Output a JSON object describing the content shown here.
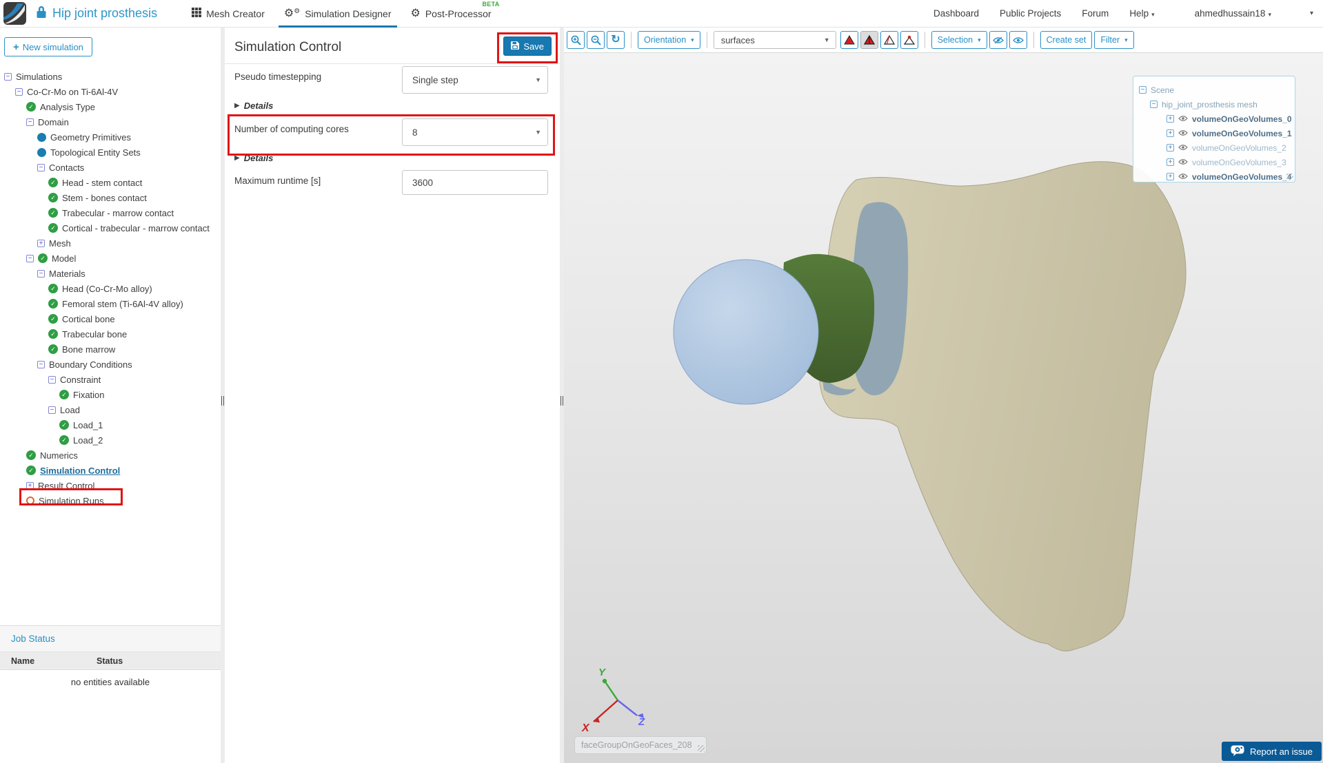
{
  "header": {
    "project_title": "Hip joint prosthesis",
    "lock_icon": "lock-icon",
    "tabs": [
      {
        "label": "Mesh Creator",
        "icon": "grid-icon",
        "active": false
      },
      {
        "label": "Simulation Designer",
        "icon": "gears-icon",
        "active": true
      },
      {
        "label": "Post-Processor",
        "icon": "gear-icon",
        "badge": "BETA",
        "active": false
      }
    ],
    "nav": [
      "Dashboard",
      "Public Projects",
      "Forum"
    ],
    "help_label": "Help",
    "username": "ahmedhussain18"
  },
  "sidebar": {
    "new_simulation_label": "New simulation",
    "tree": [
      {
        "level": 0,
        "icons": [
          "minus"
        ],
        "label": "Simulations"
      },
      {
        "level": 1,
        "icons": [
          "minus"
        ],
        "label": "Co-Cr-Mo on Ti-6Al-4V"
      },
      {
        "level": 2,
        "icons": [
          "check"
        ],
        "label": "Analysis Type"
      },
      {
        "level": 2,
        "icons": [
          "minus"
        ],
        "label": "Domain"
      },
      {
        "level": 3,
        "icons": [
          "dot"
        ],
        "label": "Geometry Primitives"
      },
      {
        "level": 3,
        "icons": [
          "dot"
        ],
        "label": "Topological Entity Sets"
      },
      {
        "level": 3,
        "icons": [
          "minus"
        ],
        "label": "Contacts"
      },
      {
        "level": 4,
        "icons": [
          "check"
        ],
        "label": "Head - stem contact"
      },
      {
        "level": 4,
        "icons": [
          "check"
        ],
        "label": "Stem - bones contact"
      },
      {
        "level": 4,
        "icons": [
          "check"
        ],
        "label": "Trabecular - marrow contact"
      },
      {
        "level": 4,
        "icons": [
          "check"
        ],
        "label": "Cortical - trabecular - marrow contact"
      },
      {
        "level": 3,
        "icons": [
          "plus"
        ],
        "label": "Mesh"
      },
      {
        "level": 2,
        "icons": [
          "minus",
          "check"
        ],
        "label": "Model"
      },
      {
        "level": 3,
        "icons": [
          "minus"
        ],
        "label": "Materials"
      },
      {
        "level": 4,
        "icons": [
          "check"
        ],
        "label": "Head (Co-Cr-Mo alloy)"
      },
      {
        "level": 4,
        "icons": [
          "check"
        ],
        "label": "Femoral stem (Ti-6Al-4V alloy)"
      },
      {
        "level": 4,
        "icons": [
          "check"
        ],
        "label": "Cortical bone"
      },
      {
        "level": 4,
        "icons": [
          "check"
        ],
        "label": "Trabecular bone"
      },
      {
        "level": 4,
        "icons": [
          "check"
        ],
        "label": "Bone marrow"
      },
      {
        "level": 3,
        "icons": [
          "minus"
        ],
        "label": "Boundary Conditions"
      },
      {
        "level": 4,
        "icons": [
          "minus"
        ],
        "label": "Constraint"
      },
      {
        "level": 5,
        "icons": [
          "check"
        ],
        "label": "Fixation"
      },
      {
        "level": 4,
        "icons": [
          "minus"
        ],
        "label": "Load"
      },
      {
        "level": 5,
        "icons": [
          "check"
        ],
        "label": "Load_1"
      },
      {
        "level": 5,
        "icons": [
          "check"
        ],
        "label": "Load_2"
      },
      {
        "level": 2,
        "icons": [
          "check"
        ],
        "label": "Numerics"
      },
      {
        "level": 2,
        "icons": [
          "check"
        ],
        "label": "Simulation Control",
        "selected": true
      },
      {
        "level": 2,
        "icons": [
          "plus"
        ],
        "label": "Result Control"
      },
      {
        "level": 2,
        "icons": [
          "circle"
        ],
        "label": "Simulation Runs"
      }
    ],
    "job_status": {
      "title": "Job Status",
      "columns": [
        "Name",
        "Status"
      ],
      "empty_text": "no entities available"
    }
  },
  "panel": {
    "title": "Simulation Control",
    "save_label": "Save",
    "details_label": "Details",
    "fields": [
      {
        "label": "Pseudo timestepping",
        "type": "select",
        "value": "Single step"
      },
      {
        "label": "Number of computing cores",
        "type": "select",
        "value": "8",
        "highlighted": true
      },
      {
        "label": "Maximum runtime [s]",
        "type": "input",
        "value": "3600"
      }
    ]
  },
  "viewport": {
    "toolbar": {
      "zoom_in_icon": "magnifier-plus",
      "zoom_out_icon": "magnifier-minus",
      "refresh_icon": "refresh-arrows",
      "orientation_label": "Orientation",
      "surfaces_value": "surfaces",
      "render_modes": [
        "surface",
        "surface-edges",
        "wireframe",
        "points"
      ],
      "active_render_mode": "surface-edges",
      "selection_label": "Selection",
      "hide_icon": "eye-slash",
      "show_icon": "eye",
      "create_set_label": "Create set",
      "filter_label": "Filter"
    },
    "scene_tree": {
      "root_label": "Scene",
      "mesh_label": "hip_joint_prosthesis mesh",
      "volumes": [
        {
          "label": "volumeOnGeoVolumes_0",
          "bold": true
        },
        {
          "label": "volumeOnGeoVolumes_1",
          "bold": true
        },
        {
          "label": "volumeOnGeoVolumes_2",
          "bold": false
        },
        {
          "label": "volumeOnGeoVolumes_3",
          "bold": false
        },
        {
          "label": "volumeOnGeoVolumes_4",
          "bold": true
        }
      ]
    },
    "axis": {
      "x": "X",
      "y": "Y",
      "z": "Z"
    },
    "selection_box_text": "faceGroupOnGeoFaces_208",
    "report_issue_label": "Report an issue"
  },
  "colors": {
    "accent_blue": "#2a8fc5",
    "title_blue": "#2e96c8",
    "save_blue": "#1878b0",
    "selected_blue": "#1e6e9c",
    "annotation_red": "#e01414",
    "beta_green": "#3aaa35",
    "check_green": "#2f9e44",
    "node_blue": "#1a7db0",
    "runs_orange": "#e0662d",
    "report_blue": "#0a5a96",
    "bone_light": "#d6d0b5",
    "bone_dark": "#c2bb9e",
    "cavity": "#91a6b2",
    "stem_green": "#567b3a",
    "stem_dark": "#3f5c2a",
    "head_light": "#c6d7ea",
    "head_blue": "#a3bddb"
  }
}
